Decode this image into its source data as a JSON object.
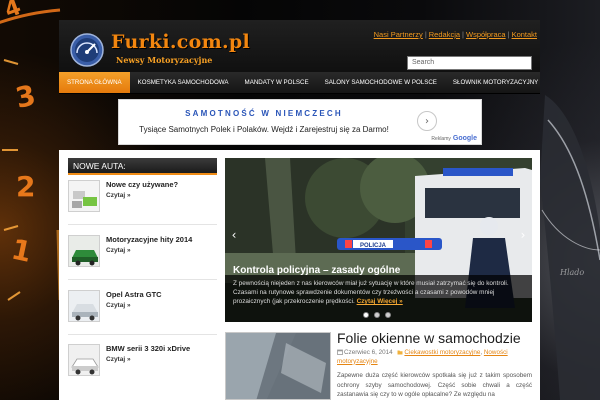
{
  "site": {
    "title": "Furki.com.pl",
    "subtitle": "Newsy Motoryzacyjne"
  },
  "top_links": [
    "Nasi Partnerzy",
    "Redakcja",
    "Współpraca",
    "Kontakt"
  ],
  "search": {
    "placeholder": "Search"
  },
  "nav": {
    "items": [
      {
        "label": "Strona Główna",
        "active": true
      },
      {
        "label": "Kosmetyka samochodowa",
        "active": false
      },
      {
        "label": "Mandaty w Polsce",
        "active": false
      },
      {
        "label": "Salony samochodowe w Polsce",
        "active": false
      },
      {
        "label": "Słownik motoryzacyjny",
        "active": false
      }
    ]
  },
  "ad": {
    "title": "SAMOTNOŚĆ W NIEMCZECH",
    "text": "Tysiące Samotnych Polek i Polaków. Wejdź i Zarejestruj się za Darmo!",
    "credit_label": "Reklamy",
    "credit_brand": "Google"
  },
  "sidebar": {
    "heading": "NOWE AUTA:",
    "items": [
      {
        "title": "Nowe czy używane?",
        "more": "Czytaj »"
      },
      {
        "title": "Motoryzacyjne hity 2014",
        "more": "Czytaj »"
      },
      {
        "title": "Opel Astra GTC",
        "more": "Czytaj »"
      },
      {
        "title": "BMW serii 3 320i xDrive",
        "more": "Czytaj »"
      }
    ]
  },
  "slider": {
    "title": "Kontrola policyjna – zasady ogólne",
    "text": "Z pewnością niejeden z nas kierowców miał już sytuację w które musiał zatrzymać się do kontroli. Czasami na rutynowe sprawdzenie dokumentów czy trzeźwości a czasami z powodów mniej prozaicznych (jak przekroczenie prędkości.",
    "more": "Czytaj Więcej »",
    "badge": "POLICJA",
    "slides": 3,
    "active_slide": 1
  },
  "article": {
    "title": "Folie okienne w samochodzie",
    "date": "Czerwiec 6, 2014",
    "categories": [
      "Ciekawostki motoryzacyjne",
      "Nowości motoryzacyjne"
    ],
    "body": "Zapewne duża część kierowców spotkała się już z takim sposobem ochrony szyby samochodowej. Część sobie chwali a część zastanawia się czy to w ogóle opłacalne? Ze względu na"
  },
  "colors": {
    "accent": "#f08c15",
    "link": "#e58512",
    "nav_bg": "#1d1d1d",
    "content_bg": "#ffffff"
  }
}
